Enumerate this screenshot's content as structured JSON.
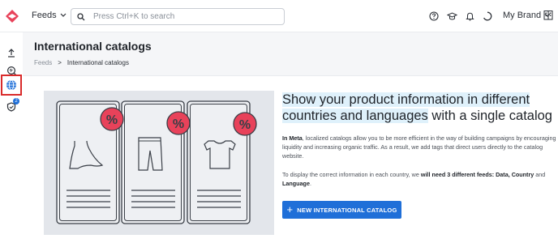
{
  "topbar": {
    "feeds_label": "Feeds",
    "search_placeholder": "Press Ctrl+K to search",
    "brand_label": "My Brand",
    "icons": [
      "help-icon",
      "academy-icon",
      "bell-icon",
      "status-icon",
      "building-icon"
    ]
  },
  "sidebar": {
    "items": [
      "upload-icon",
      "search-feeds-icon",
      "globe-icon",
      "shield-badge-icon"
    ],
    "active_index": 2,
    "badge_count": "2"
  },
  "page": {
    "title": "International catalogs",
    "breadcrumb": [
      "Feeds",
      "International catalogs"
    ],
    "breadcrumb_separator": ">"
  },
  "content": {
    "headline_part1": "Show your product information  in different countries and  languages",
    "headline_part2": " with a single catalog",
    "intro_bold": "In Meta",
    "intro_text": ", localized catalogs allow you to be more efficient in the way of building campaigns by encouraging liquidity and increasing organic traffic. As a result, we add tags that direct users directly to the catalog website.",
    "feeds_text_1": "To display the correct information in each country, we ",
    "feeds_bold": "will need 3 different feeds: Data, Country",
    "feeds_text_2": " and ",
    "feeds_bold_2": "Language",
    "feeds_text_3": ".",
    "cta_label": "NEW INTERNATIONAL CATALOG",
    "cta_plus": "+"
  },
  "illustration": {
    "badge_symbol": "%"
  },
  "colors": {
    "accent": "#1f6fd8",
    "badge_red": "#e8425a",
    "highlight": "#dff1fb",
    "active_outline": "#d92b2b",
    "logo_red": "#e8425a"
  }
}
